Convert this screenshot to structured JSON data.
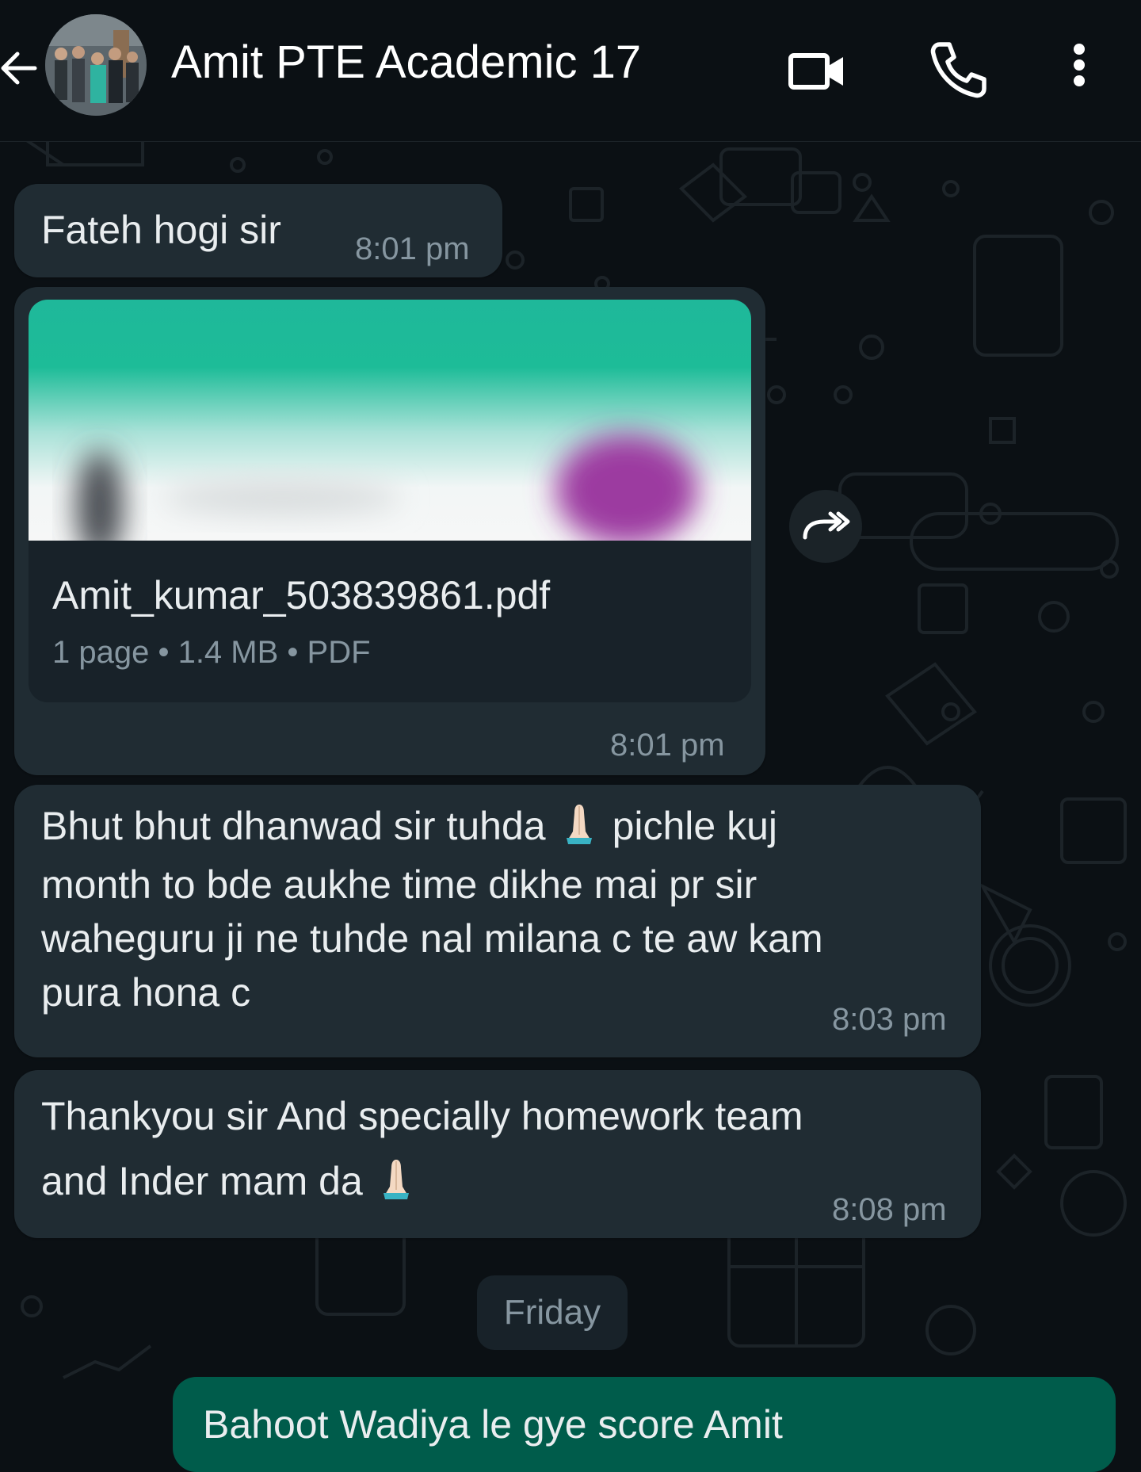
{
  "header": {
    "title": "Amit PTE Academic 17",
    "back_icon": "arrow-left-icon",
    "video_call_icon": "video-camera-icon",
    "voice_call_icon": "phone-icon",
    "menu_icon": "more-vertical-icon"
  },
  "messages": [
    {
      "text": "Fateh hogi sir",
      "time": "8:01 pm"
    },
    {
      "document": {
        "file_name": "Amit_kumar_503839861.pdf",
        "meta": "1 page • 1.4 MB • PDF"
      },
      "time": "8:01 pm"
    },
    {
      "lines": [
        {
          "before_emoji": "Bhut bhut dhanwad sir tuhda",
          "emoji": "folded-hands-icon",
          "after_emoji": "pichle kuj"
        },
        "month to bde aukhe time dikhe mai pr sir",
        "waheguru ji ne tuhde nal milana c te aw kam",
        "pura hona c"
      ],
      "time": "8:03 pm"
    },
    {
      "lines": [
        "Thankyou sir And specially homework team",
        {
          "before_emoji": "and Inder mam da",
          "emoji": "folded-hands-icon"
        }
      ],
      "time": "8:08 pm"
    }
  ],
  "forward_icon": "forward-icon",
  "date_separator": "Friday",
  "outgoing_partial": {
    "text": "Bahoot Wadiya le gye score Amit"
  },
  "colors": {
    "background": "#0b1014",
    "incoming_bubble": "#202c33",
    "outgoing_bubble": "#005c4b",
    "timestamp": "#8696a0",
    "doc_thumb_teal": "#1fb89a"
  }
}
